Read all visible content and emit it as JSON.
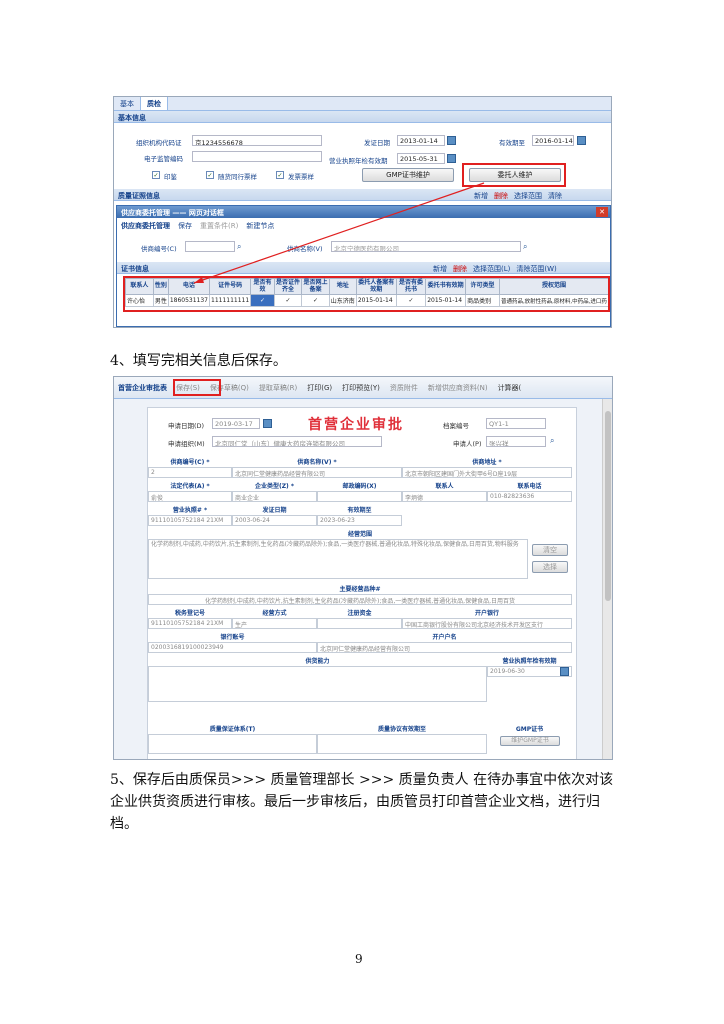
{
  "shot1": {
    "tabs": [
      "基本",
      "质检"
    ],
    "section_basic": "基本信息",
    "org_code_label": "组织机构代码证",
    "org_code_value": "京1234556678",
    "issue_date_label": "发证日期",
    "issue_date_value": "2013-01-14",
    "valid_until_label": "有效期至",
    "valid_until_value": "2016-01-14",
    "e_code_label": "电子监管编码",
    "license_check_label": "营业执照年检有效期",
    "license_check_value": "2015-05-31",
    "checkboxes": [
      {
        "label": "印鉴",
        "checked": true
      },
      {
        "label": "随货同行票样",
        "checked": true
      },
      {
        "label": "发票票样",
        "checked": true
      }
    ],
    "gmp_button": "GMP证书维护",
    "entrust_button": "委托人维护",
    "section_quality": "质量证照信息",
    "toolbar_add": "新增",
    "toolbar_delete": "删除",
    "toolbar_select": "选择范围",
    "toolbar_clear": "清除",
    "dialog_title": "供应商委托管理 —— 网页对话框",
    "dialog_tabs": [
      "供应商委托管理",
      "保存",
      "重置条件(R)",
      "新建节点"
    ],
    "supplier_code_label": "供商编号(C)",
    "supplier_name_label": "供商名称(V)",
    "supplier_name_value": "北京宁德医药有限公司",
    "cert_section": "证书信息",
    "cert_toolbar": [
      "新增",
      "删除",
      "选择范围(L)",
      "清除范围(W)"
    ],
    "grid_headers": [
      "联系人",
      "性别",
      "电话",
      "证件号码",
      "是否有效",
      "是否证件齐全",
      "是否网上备案",
      "地址",
      "委托人备案有效期",
      "是否有委托书",
      "委托书有效期",
      "许可类型",
      "授权范围"
    ],
    "grid_row": [
      "许心怡",
      "男性",
      "1860531137",
      "1111111111",
      "✓",
      "✓",
      "✓",
      "山东济南",
      "2015-01-14",
      "✓",
      "2015-01-14",
      "商品类别",
      "普通药品,放射性药品,原材料,中药品,进口药"
    ]
  },
  "step4_text": "4、填写完相关信息后保存。",
  "shot2": {
    "module_title": "首营企业审批表",
    "toolbar": [
      "保存(S)",
      "保存草稿(Q)",
      "提取草稿(R)",
      "打印(G)",
      "打印预览(Y)",
      "资质附件",
      "新增供应商资料(N)",
      "计算器("
    ],
    "form_title": "首营企业审批",
    "apply_date_label": "申请日期(D)",
    "apply_date_value": "2019-03-17",
    "archive_label": "档案编号",
    "archive_value": "QY1-1",
    "apply_org_label": "申请组织(M)",
    "apply_org_value": "北京同仁堂（山东）健康大药房连锁有限公司",
    "applicant_label": "申请人(P)",
    "applicant_value": "张兴祥",
    "row1_headers": [
      "供商编号(C) *",
      "供商名称(V) *",
      "供商地址 *"
    ],
    "row1_values": [
      "2",
      "北京同仁堂健康药品经营有限公司",
      "北京市朝阳区建国门外大街甲6号D座19层"
    ],
    "row2_headers": [
      "法定代表(A) *",
      "企业类型(Z) *",
      "邮政编码(X)",
      "联系人",
      "联系电话"
    ],
    "row2_values": [
      "俞俊",
      "商业企业",
      "",
      "李炳德",
      "010-82823636"
    ],
    "row3_headers": [
      "营业执照# *",
      "发证日期",
      "有效期至"
    ],
    "row3_values": [
      "91110105752184 21XM",
      "2003-06-24",
      "2023-06-23"
    ],
    "scope_header": "经营范围",
    "scope_value": "化学药制剂,中成药,中药饮片,抗生素制剂,生化药品(冷藏药品除外);食品,一类医疗器械,普通化妆品,特殊化妆品,保健食品,日用百货,物料服务",
    "clear_button": "清空",
    "select_button": "选择",
    "main_scope_header": "主要经营品种#",
    "main_scope_value": "化学药制剂,中成药,中药饮片,抗生素制剂,生化药品(冷藏药品除外);食品,一类医疗器械,普通化妆品,保健食品,日用百货",
    "row4_headers": [
      "税务登记号",
      "经营方式",
      "注册资金",
      "开户银行"
    ],
    "row4_values": [
      "91110105752184 21XM",
      "生产",
      "",
      "中国工商银行股份有限公司北京经济技术开发区支行"
    ],
    "row5_headers": [
      "银行账号",
      "开户户名"
    ],
    "row5_values": [
      "0200316819100023949",
      "北京同仁堂健康药品经营有限公司"
    ],
    "row6_headers": [
      "供货能力",
      "营业执照年检有效期"
    ],
    "row6_values": [
      "",
      "2019-06-30"
    ],
    "row7_headers": [
      "质量保证体系(T)",
      "质量协议有效期至",
      "GMP证书"
    ],
    "gmp_maint": "维护GMP证书"
  },
  "step5_text_line1": "5、保存后由质保员>>> 质量管理部长 >>> 质量负责人 在待办事宜中依次对该",
  "step5_text_line2": "企业供货资质进行审核。最后一步审核后，由质管员打印首营企业文档，进行归",
  "step5_text_line3": "档。",
  "page_number": "9"
}
